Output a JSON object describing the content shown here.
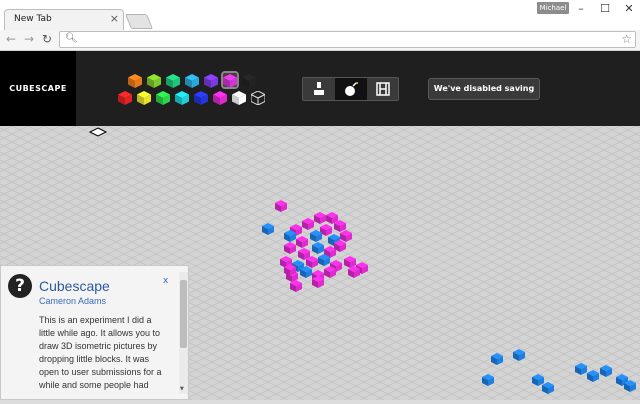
{
  "browser": {
    "tab_title": "New Tab",
    "tab_close": "×",
    "profile": "Michael",
    "window_controls": {
      "minimize": "–",
      "maximize": "☐",
      "close": "✕"
    },
    "nav": {
      "back": "←",
      "forward": "→",
      "reload": "↻"
    },
    "omnibox": {
      "value": "",
      "placeholder": ""
    }
  },
  "app": {
    "logo": "CUBESCAPE",
    "palette_row1": [
      "#e87a1a",
      "#7ec82a",
      "#1fc77a",
      "#2aa8d8",
      "#7a3ae0",
      "#d235d2",
      "#222222"
    ],
    "palette_row2": [
      "#e22424",
      "#e8e22a",
      "#2ad64a",
      "#1ecfd8",
      "#2436e0",
      "#e02ad0",
      "#ffffff",
      "outline"
    ],
    "selected_color": "#d235d2",
    "tools": [
      "place-block-tool",
      "bomb-tool",
      "film-tool"
    ],
    "active_tool": "bomb-tool",
    "save_label": "We've disabled saving",
    "icons": {
      "pen": "pen-icon",
      "bomb": "bomb-icon",
      "film": "film-icon"
    }
  },
  "info": {
    "icon": "?",
    "title": "Cubescape",
    "author": "Cameron Adams",
    "close": "x",
    "body": "This is an experiment I did a little while ago. It allows you to draw 3D isometric pictures by dropping little blocks. It was open to user submissions for a while and some people had"
  }
}
